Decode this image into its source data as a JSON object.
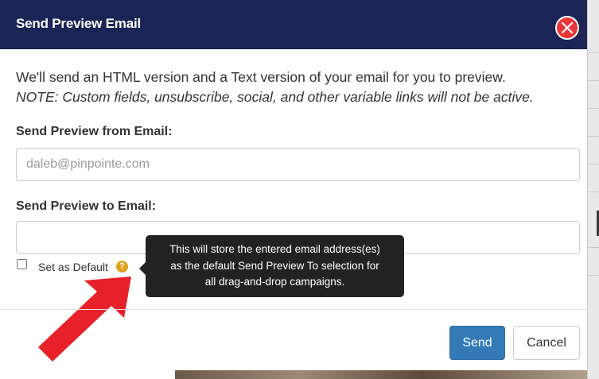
{
  "dialog": {
    "title": "Send Preview Email",
    "intro": "We'll send an HTML version and a Text version of your email for you to preview.",
    "note": "NOTE: Custom fields, unsubscribe, social, and other variable links will not be active.",
    "from_label": "Send Preview from Email:",
    "from_placeholder": "daleb@pinpointe.com",
    "to_label": "Send Preview to Email:",
    "to_value": "",
    "set_default_label": "Set as Default",
    "set_default_checked": false,
    "help_icon_glyph": "?",
    "tooltip_lines": [
      "This will store the entered email address(es)",
      "as the default Send Preview To selection for",
      "all drag-and-drop campaigns."
    ],
    "send_label": "Send",
    "cancel_label": "Cancel"
  },
  "icons": {
    "close": "close-icon",
    "help": "question-icon",
    "annotation": "red-arrow-icon"
  },
  "colors": {
    "header_bg": "#1b2455",
    "close_bg": "#e8363a",
    "primary": "#337ab7",
    "help": "#e0a21b",
    "annotation_arrow": "#e8202a"
  }
}
